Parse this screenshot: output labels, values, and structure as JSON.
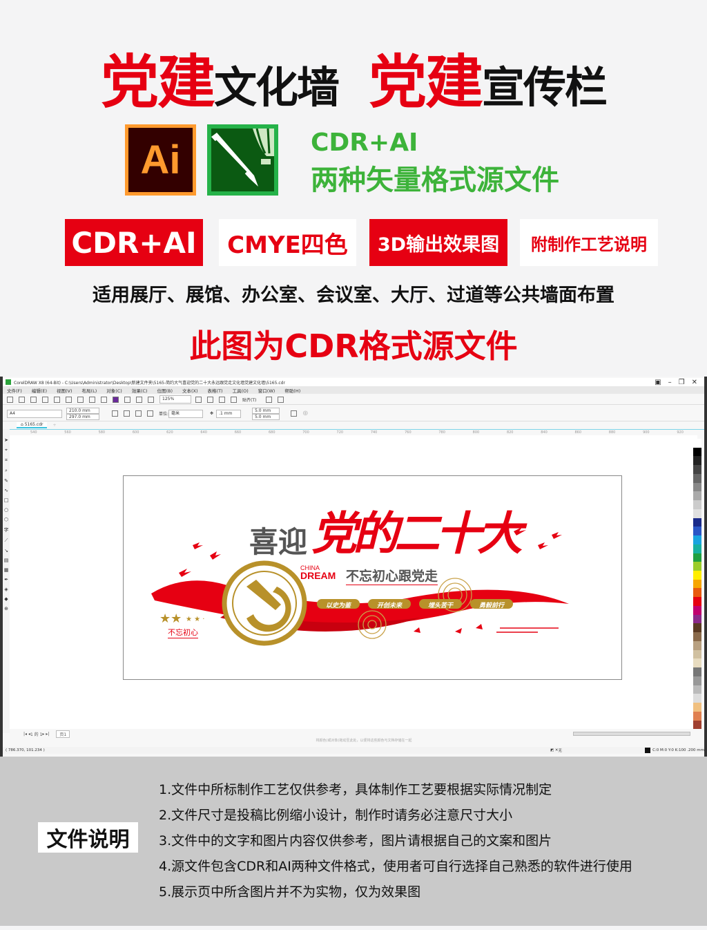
{
  "header": {
    "title_parts": [
      {
        "text": "党建",
        "style": "big"
      },
      {
        "text": "文化墙",
        "style": "sm"
      },
      {
        "text": "  "
      },
      {
        "text": "党建",
        "style": "big"
      },
      {
        "text": "宣传栏",
        "style": "sm"
      }
    ]
  },
  "logos": {
    "ai_text": "Ai",
    "ai_icon": "adobe-illustrator-icon",
    "cdr_icon": "coreldraw-balloon-pen-icon"
  },
  "format": {
    "line1": "CDR+AI",
    "line2": "两种矢量格式源文件"
  },
  "badges": [
    "CDR+AI",
    "CMYE四色",
    "3D输出效果图",
    "附制作工艺说明"
  ],
  "usage": "适用展厅、展馆、办公室、会议室、大厅、过道等公共墙面布置",
  "source_note": "此图为CDR格式源文件",
  "colors": {
    "red": "#e60012",
    "green": "#3db33a",
    "gold": "#b8912a"
  },
  "app": {
    "title": "CorelDRAW X8 (64-Bit) - C:\\Users\\Administrator\\Desktop\\新建文件夹\\5165-简约大气喜迎党的二十大永远跟党走文化墙党建文化墙\\5165.cdr",
    "menu": [
      "文件(F)",
      "编辑(E)",
      "视图(V)",
      "布局(L)",
      "对象(C)",
      "效果(C)",
      "位图(B)",
      "文本(X)",
      "表格(T)",
      "工具(O)",
      "窗口(W)",
      "帮助(H)"
    ],
    "zoom": "125%",
    "snap": "贴齐(T)",
    "page_size": "A4",
    "width": "210.0 mm",
    "height": "297.0 mm",
    "unit_label": "单位:",
    "unit": "毫米",
    "nudge": ".1 mm",
    "dup_x": "5.0 mm",
    "dup_y": "5.0 mm",
    "doc_tab": "5165.cdr",
    "ruler": [
      "540",
      "560",
      "580",
      "600",
      "620",
      "640",
      "660",
      "680",
      "700",
      "720",
      "740",
      "760",
      "780",
      "800",
      "820",
      "840",
      "860",
      "880",
      "900",
      "920"
    ],
    "page_nav": "1 的 1",
    "page_tab": "页1",
    "hint": "将颜色(或对象)拖动至此处，以便将这些颜色与文档存储在一起",
    "coords": "( 786.370, 101.234 )",
    "fill_none": "无",
    "outline_info": "C:0 M:0 Y:0 K:100  .200 mm"
  },
  "artwork": {
    "headline_gray": "喜迎",
    "headline_red": "党的二十大",
    "china": "CHINA",
    "dream": "DREAM",
    "slogan": "不忘初心跟党走",
    "pills": [
      "以史为鉴",
      "开创未来",
      "埋头苦干",
      "勇毅前行"
    ],
    "small_slogan": "不忘初心"
  },
  "notes": {
    "label": "文件说明",
    "items": [
      "1.文件中所标制作工艺仅供参考，具体制作工艺要根据实际情况制定",
      "2.文件尺寸是投稿比例缩小设计，制作时请务必注意尺寸大小",
      "3.文件中的文字和图片内容仅供参考，图片请根据自己的文案和图片",
      "4.源文件包含CDR和AI两种文件格式，使用者可自行选择自己熟悉的软件进行使用",
      "5.展示页中所含图片并不为实物，仅为效果图"
    ]
  }
}
